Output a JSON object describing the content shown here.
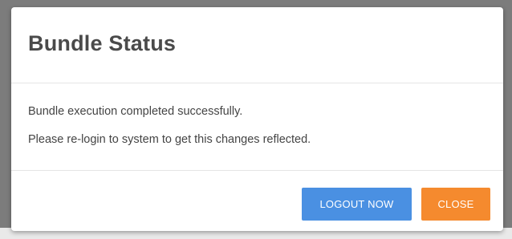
{
  "dialog": {
    "title": "Bundle Status",
    "message_lines": [
      "Bundle execution completed successfully.",
      "Please re-login to system to get this changes reflected."
    ],
    "buttons": {
      "logout_label": "LOGOUT NOW",
      "close_label": "CLOSE"
    }
  },
  "colors": {
    "logout_button": "#4a90e2",
    "close_button": "#f58a2e",
    "title_text": "#4a4a4a",
    "body_text": "#444444"
  }
}
